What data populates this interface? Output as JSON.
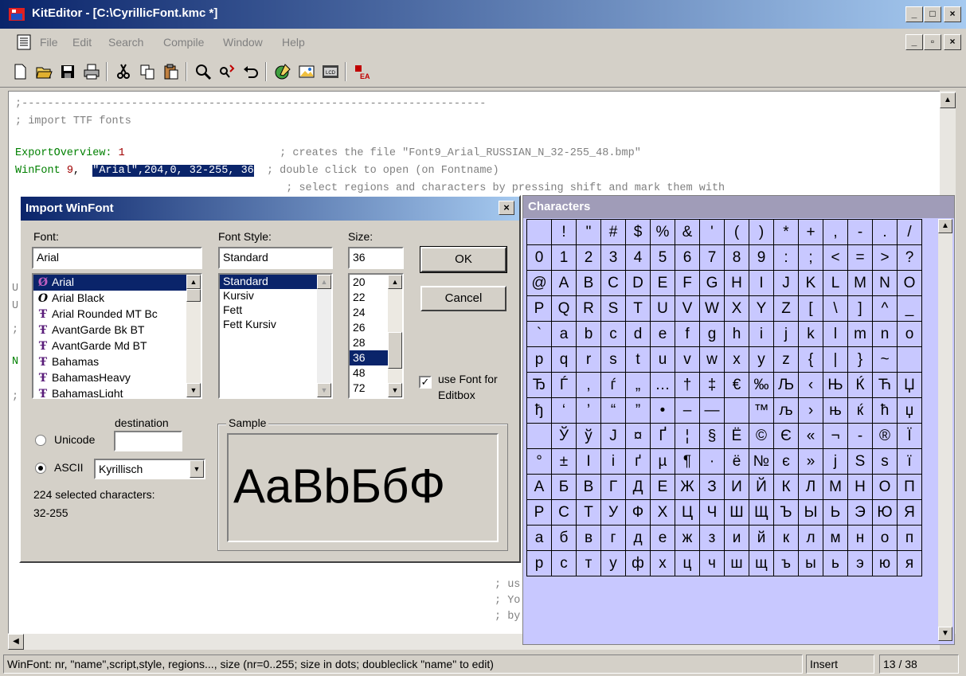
{
  "window": {
    "title": "KitEditor - [C:\\CyrillicFont.kmc *]",
    "buttons": [
      "_",
      "□",
      "×"
    ],
    "mdi_buttons": [
      "_",
      "▫",
      "×"
    ]
  },
  "menu": [
    "File",
    "Edit",
    "Search",
    "Compile",
    "Window",
    "Help"
  ],
  "toolbar_icons": [
    "new-file-icon",
    "open-folder-icon",
    "save-icon",
    "print-icon",
    "cut-icon",
    "copy-icon",
    "paste-icon",
    "find-icon",
    "replace-icon",
    "undo-icon",
    "compile-icon",
    "image-icon",
    "lcd-icon",
    "ea-icon"
  ],
  "editor": {
    "lines": [
      {
        "segments": [
          {
            "t": ";------------------------------------------------------------------------",
            "c": "gray"
          }
        ]
      },
      {
        "segments": [
          {
            "t": "; import TTF fonts",
            "c": "gray"
          }
        ]
      },
      {
        "segments": [
          {
            "t": "ExportOverview: ",
            "c": "green"
          },
          {
            "t": "1",
            "c": "red"
          },
          {
            "t": "                        ; creates the file \"Font9_Arial_RUSSIAN_N_32-255_48.bmp\"",
            "c": "gray"
          }
        ]
      },
      {
        "segments": [
          {
            "t": "WinFont ",
            "c": "green"
          },
          {
            "t": "9",
            "c": "red"
          },
          {
            "t": ",  ",
            "c": "black"
          },
          {
            "t": "\"Arial\",204,0, 32-255, 36",
            "c": "sel"
          },
          {
            "t": "  ",
            "c": "black"
          },
          {
            "t": "; double click to open (on Fontname)",
            "c": "gray"
          }
        ]
      },
      {
        "segments": [
          {
            "t": "                                          ; select regions and characters by pressing shift and mark them with",
            "c": "gray"
          }
        ]
      }
    ],
    "fragments": [
      {
        "t": "U",
        "c": "gray"
      },
      {
        "t": "U",
        "c": "gray"
      },
      {
        "t": ";",
        "c": "gray"
      },
      {
        "t": "N",
        "c": "green"
      },
      {
        "t": ";",
        "c": "gray"
      },
      {
        "t": "; us",
        "c": "gray"
      },
      {
        "t": "; Yo",
        "c": "gray"
      },
      {
        "t": "; by",
        "c": "gray"
      }
    ]
  },
  "status": {
    "hint": "WinFont: nr, \"name\",script,style, regions..., size (nr=0..255; size in dots; doubleclick \"name\" to edit)",
    "mode": "Insert",
    "position": "13 / 38"
  },
  "dialog": {
    "title": "Import WinFont",
    "font_label": "Font:",
    "font_value": "Arial",
    "fonts": [
      {
        "name": "Arial",
        "icon": "opentype"
      },
      {
        "name": "Arial Black",
        "icon": "opentype"
      },
      {
        "name": "Arial Rounded MT Bc",
        "icon": "truetype"
      },
      {
        "name": "AvantGarde Bk BT",
        "icon": "truetype"
      },
      {
        "name": "AvantGarde Md BT",
        "icon": "truetype"
      },
      {
        "name": "Bahamas",
        "icon": "truetype"
      },
      {
        "name": "BahamasHeavy",
        "icon": "truetype"
      },
      {
        "name": "BahamasLight",
        "icon": "truetype"
      }
    ],
    "style_label": "Font Style:",
    "style_value": "Standard",
    "styles": [
      "Standard",
      "Kursiv",
      "Fett",
      "Fett Kursiv"
    ],
    "size_label": "Size:",
    "size_value": "36",
    "sizes": [
      "20",
      "22",
      "24",
      "26",
      "28",
      "36",
      "48",
      "72"
    ],
    "ok": "OK",
    "cancel": "Cancel",
    "use_font_line1": "use Font for",
    "use_font_line2": "Editbox",
    "use_font_checked": true,
    "destination_label": "destination",
    "unicode_label": "Unicode",
    "ascii_label": "ASCII",
    "ascii_value": "Kyrillisch",
    "selected_count": "224 selected characters:",
    "selected_range": "32-255",
    "sample_label": "Sample",
    "sample_text": "AaBbБбФ"
  },
  "characters": {
    "title": "Characters",
    "rows": [
      [
        " ",
        "!",
        "\"",
        "#",
        "$",
        "%",
        "&",
        "'",
        "(",
        ")",
        "*",
        "+",
        ",",
        "-",
        ".",
        "/"
      ],
      [
        "0",
        "1",
        "2",
        "3",
        "4",
        "5",
        "6",
        "7",
        "8",
        "9",
        ":",
        ";",
        "<",
        "=",
        ">",
        "?"
      ],
      [
        "@",
        "A",
        "B",
        "C",
        "D",
        "E",
        "F",
        "G",
        "H",
        "I",
        "J",
        "K",
        "L",
        "M",
        "N",
        "O"
      ],
      [
        "P",
        "Q",
        "R",
        "S",
        "T",
        "U",
        "V",
        "W",
        "X",
        "Y",
        "Z",
        "[",
        "\\",
        "]",
        "^",
        "_"
      ],
      [
        "`",
        "a",
        "b",
        "c",
        "d",
        "e",
        "f",
        "g",
        "h",
        "i",
        "j",
        "k",
        "l",
        "m",
        "n",
        "o"
      ],
      [
        "p",
        "q",
        "r",
        "s",
        "t",
        "u",
        "v",
        "w",
        "x",
        "y",
        "z",
        "{",
        "|",
        "}",
        "~",
        ""
      ],
      [
        "Ђ",
        "Ѓ",
        "‚",
        "ѓ",
        "„",
        "…",
        "†",
        "‡",
        "€",
        "‰",
        "Љ",
        "‹",
        "Њ",
        "Ќ",
        "Ћ",
        "Џ"
      ],
      [
        "ђ",
        "‘",
        "’",
        "“",
        "”",
        "•",
        "–",
        "—",
        "",
        "™",
        "љ",
        "›",
        "њ",
        "ќ",
        "ћ",
        "џ"
      ],
      [
        " ",
        "Ў",
        "ў",
        "Ј",
        "¤",
        "Ґ",
        "¦",
        "§",
        "Ё",
        "©",
        "Є",
        "«",
        "¬",
        "-",
        "®",
        "Ї"
      ],
      [
        "°",
        "±",
        "І",
        "і",
        "ґ",
        "µ",
        "¶",
        "·",
        "ё",
        "№",
        "є",
        "»",
        "ј",
        "Ѕ",
        "ѕ",
        "ї"
      ],
      [
        "А",
        "Б",
        "В",
        "Г",
        "Д",
        "Е",
        "Ж",
        "З",
        "И",
        "Й",
        "К",
        "Л",
        "М",
        "Н",
        "О",
        "П"
      ],
      [
        "Р",
        "С",
        "Т",
        "У",
        "Ф",
        "Х",
        "Ц",
        "Ч",
        "Ш",
        "Щ",
        "Ъ",
        "Ы",
        "Ь",
        "Э",
        "Ю",
        "Я"
      ],
      [
        "а",
        "б",
        "в",
        "г",
        "д",
        "е",
        "ж",
        "з",
        "и",
        "й",
        "к",
        "л",
        "м",
        "н",
        "о",
        "п"
      ],
      [
        "р",
        "с",
        "т",
        "у",
        "ф",
        "х",
        "ц",
        "ч",
        "ш",
        "щ",
        "ъ",
        "ы",
        "ь",
        "э",
        "ю",
        "я"
      ]
    ]
  }
}
